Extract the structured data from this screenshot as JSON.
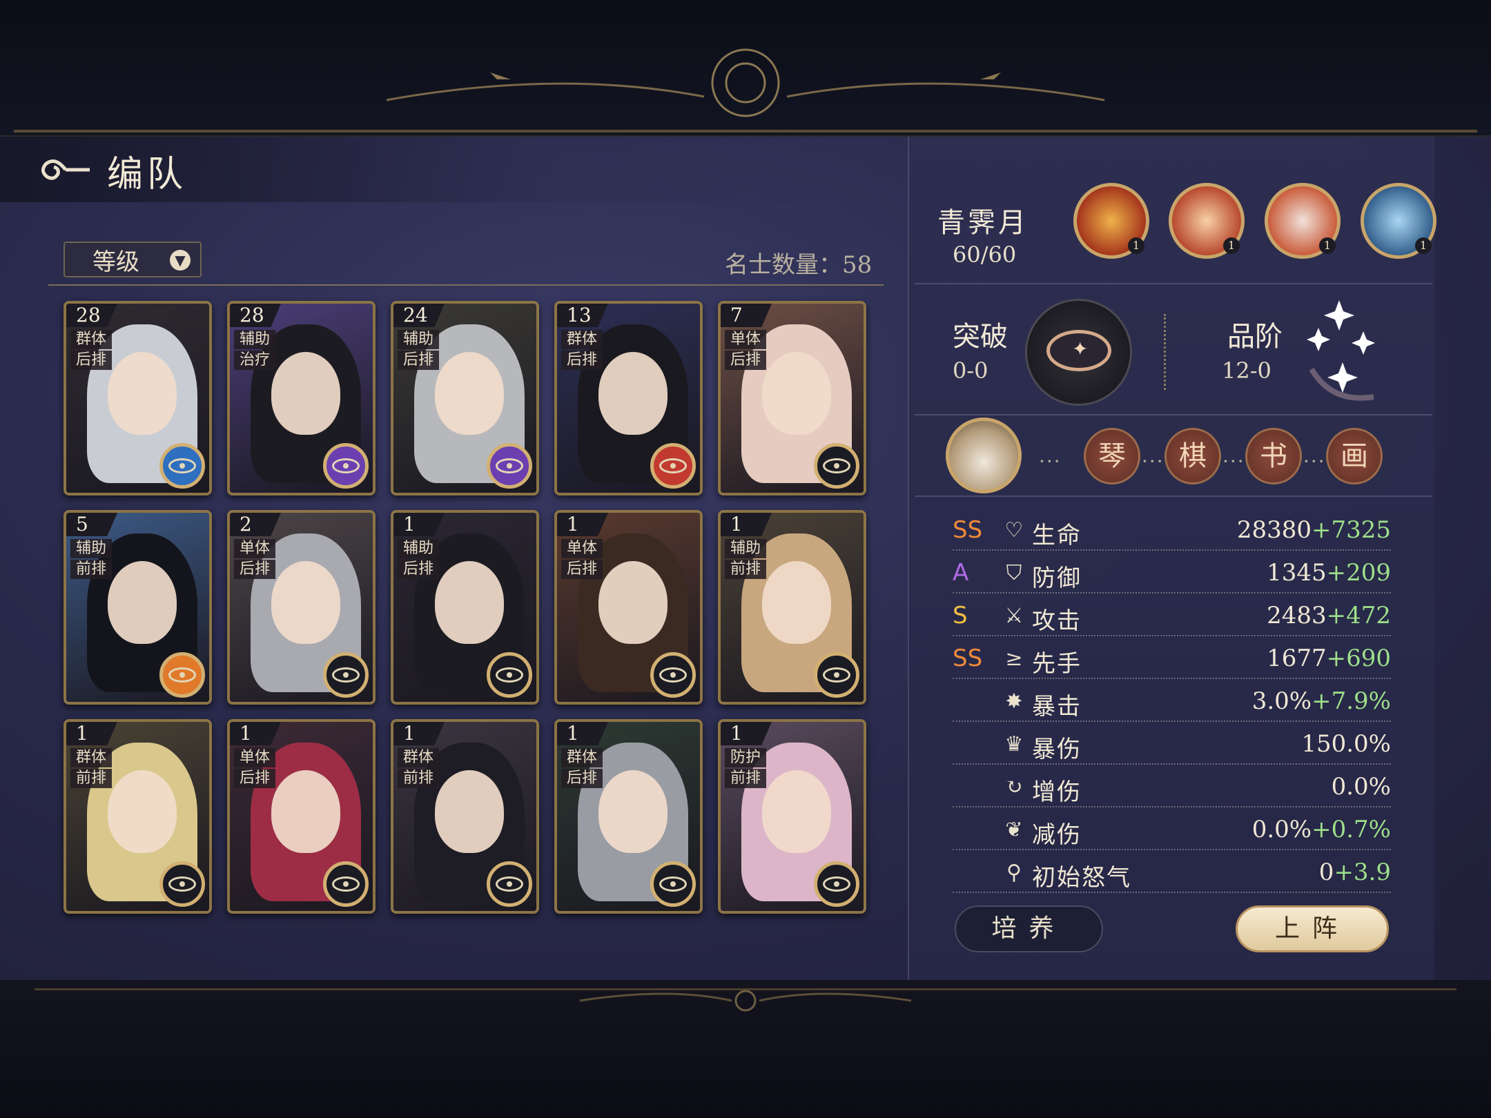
{
  "header": {
    "title": "编队"
  },
  "filter": {
    "label": "等级"
  },
  "roster": {
    "count_label": "名士数量：58",
    "cards": [
      {
        "level": "28",
        "tag1": "群体",
        "tag2": "后排",
        "hair": "#c9cdd3",
        "bg": "#2f2b31",
        "badge": "blue"
      },
      {
        "level": "28",
        "tag1": "辅助",
        "tag2": "治疗",
        "hair": "#1d1b22",
        "bg": "#4a3e78",
        "badge": "purple"
      },
      {
        "level": "24",
        "tag1": "辅助",
        "tag2": "后排",
        "hair": "#b7b8bb",
        "bg": "#3b3a35",
        "badge": "purple"
      },
      {
        "level": "13",
        "tag1": "群体",
        "tag2": "后排",
        "hair": "#1a1920",
        "bg": "#2c2f55",
        "badge": "red"
      },
      {
        "level": "7",
        "tag1": "单体",
        "tag2": "后排",
        "hair": "#e6cbc0",
        "bg": "#6e4f45",
        "badge": "dark"
      },
      {
        "level": "5",
        "tag1": "辅助",
        "tag2": "前排",
        "hair": "#14151c",
        "bg": "#3d5a86",
        "badge": "orange"
      },
      {
        "level": "2",
        "tag1": "单体",
        "tag2": "后排",
        "hair": "#a9a9b0",
        "bg": "#4d4648",
        "badge": "dark"
      },
      {
        "level": "1",
        "tag1": "辅助",
        "tag2": "后排",
        "hair": "#1c1b22",
        "bg": "#2b2733",
        "badge": "dark"
      },
      {
        "level": "1",
        "tag1": "单体",
        "tag2": "后排",
        "hair": "#3b2a22",
        "bg": "#5a3a2f",
        "badge": "dark"
      },
      {
        "level": "1",
        "tag1": "辅助",
        "tag2": "前排",
        "hair": "#c8a77f",
        "bg": "#4b4236",
        "badge": "dark"
      },
      {
        "level": "1",
        "tag1": "群体",
        "tag2": "前排",
        "hair": "#d9c78c",
        "bg": "#4a4334",
        "badge": "dark"
      },
      {
        "level": "1",
        "tag1": "单体",
        "tag2": "后排",
        "hair": "#9c2d45",
        "bg": "#3d2a35",
        "badge": "dark"
      },
      {
        "level": "1",
        "tag1": "群体",
        "tag2": "前排",
        "hair": "#1e1c24",
        "bg": "#3b3540",
        "badge": "dark"
      },
      {
        "level": "1",
        "tag1": "群体",
        "tag2": "后排",
        "hair": "#9a9ca3",
        "bg": "#2d3a33",
        "badge": "dark"
      },
      {
        "level": "1",
        "tag1": "防护",
        "tag2": "前排",
        "hair": "#dcb6c8",
        "bg": "#5a4b5e",
        "badge": "dark"
      }
    ]
  },
  "hero": {
    "name": "青霁月",
    "level": "60/60",
    "skills": [
      {
        "color1": "#f0b24a",
        "color2": "#9a2416",
        "num": "1"
      },
      {
        "color1": "#f7d0a6",
        "color2": "#b0371e",
        "num": "1"
      },
      {
        "color1": "#f1e2da",
        "color2": "#c44a26",
        "num": "1"
      },
      {
        "color1": "#a8d6f2",
        "color2": "#24507e",
        "num": "1"
      }
    ],
    "breakthrough": {
      "label": "突破",
      "value": "0-0"
    },
    "grade": {
      "label": "品阶",
      "value": "12-0"
    },
    "arts": [
      "琴",
      "棋",
      "书",
      "画"
    ],
    "stats": [
      {
        "grade": "SS",
        "grade_color": "#f08a3a",
        "icon": "♡",
        "name": "生命",
        "base": "28380",
        "bonus": "+7325"
      },
      {
        "grade": "A",
        "grade_color": "#b06ae6",
        "icon": "⛉",
        "name": "防御",
        "base": "1345",
        "bonus": "+209"
      },
      {
        "grade": "S",
        "grade_color": "#f0c040",
        "icon": "⚔",
        "name": "攻击",
        "base": "2483",
        "bonus": "+472"
      },
      {
        "grade": "SS",
        "grade_color": "#f08a3a",
        "icon": "≥",
        "name": "先手",
        "base": "1677",
        "bonus": "+690"
      },
      {
        "grade": "",
        "grade_color": "#ffffff",
        "icon": "✸",
        "name": "暴击",
        "base": "3.0%",
        "bonus": "+7.9%"
      },
      {
        "grade": "",
        "grade_color": "#ffffff",
        "icon": "♛",
        "name": "暴伤",
        "base": "150.0%",
        "bonus": ""
      },
      {
        "grade": "",
        "grade_color": "#ffffff",
        "icon": "↻",
        "name": "增伤",
        "base": "0.0%",
        "bonus": ""
      },
      {
        "grade": "",
        "grade_color": "#ffffff",
        "icon": "❦",
        "name": "减伤",
        "base": "0.0%",
        "bonus": "+0.7%"
      },
      {
        "grade": "",
        "grade_color": "#ffffff",
        "icon": "⚲",
        "name": "初始怒气",
        "base": "0",
        "bonus": "+3.9"
      }
    ]
  },
  "buttons": {
    "train": "培养",
    "deploy": "上阵"
  }
}
